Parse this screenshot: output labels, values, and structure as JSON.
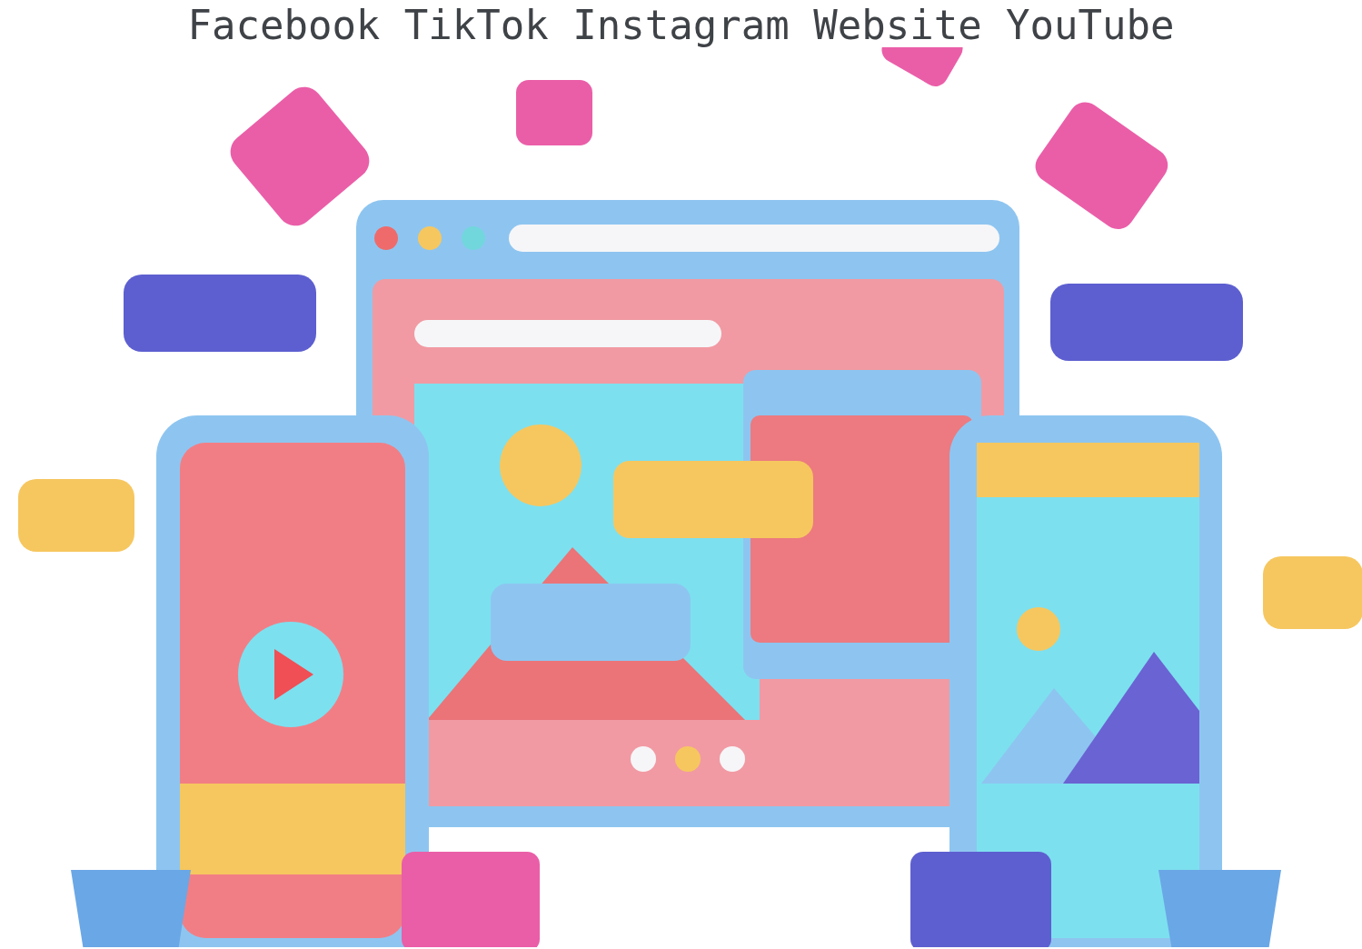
{
  "heading": {
    "text": "Facebook TikTok Instagram Website YouTube"
  },
  "illustration": {
    "kind": "social-media-devices"
  }
}
